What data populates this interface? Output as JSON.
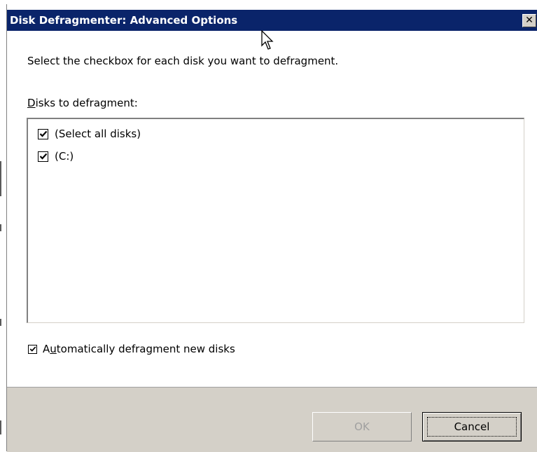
{
  "window": {
    "title": "Disk Defragmenter: Advanced Options",
    "close_label": "✕"
  },
  "instruction": "Select the checkbox for each disk you want to defragment.",
  "disks_group": {
    "label_first": "D",
    "label_rest": "isks to defragment:",
    "items": [
      {
        "label": "(Select all disks)",
        "checked": true
      },
      {
        "label": "(C:)",
        "checked": true
      }
    ]
  },
  "auto_defrag": {
    "prefix": "A",
    "underlined": "u",
    "rest": "tomatically defragment new disks",
    "checked": true
  },
  "buttons": {
    "ok_label": "OK",
    "ok_enabled": false,
    "cancel_label": "Cancel"
  },
  "colors": {
    "titlebar": "#0a246a",
    "footer": "#d4d0c8"
  }
}
